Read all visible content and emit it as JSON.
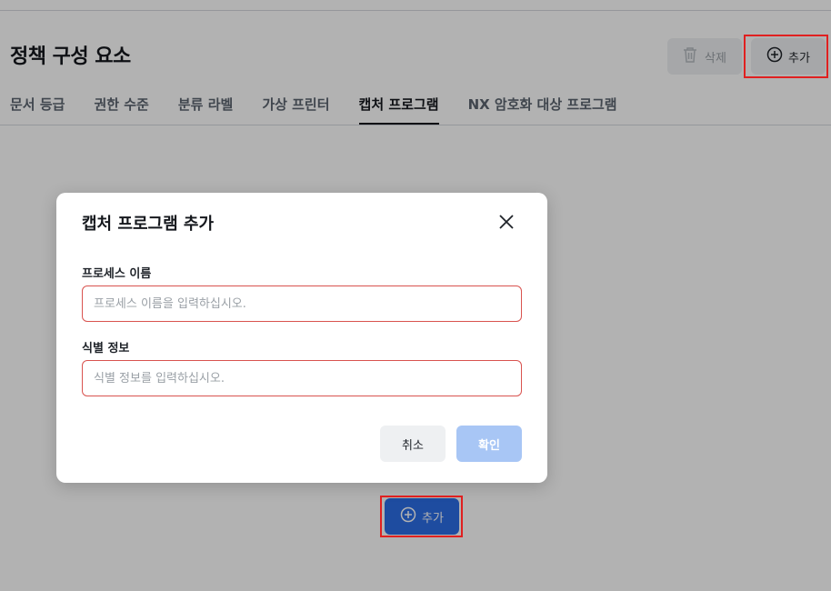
{
  "page": {
    "title": "정책 구성 요소",
    "delete_label": "삭제",
    "add_label": "추가",
    "tabs": [
      {
        "label": "문서 등급"
      },
      {
        "label": "권한 수준"
      },
      {
        "label": "분류 라벨"
      },
      {
        "label": "가상 프린터"
      },
      {
        "label": "캡처 프로그램"
      },
      {
        "label": "NX 암호화 대상 프로그램"
      }
    ],
    "active_tab": "캡처 프로그램",
    "center_add_label": "추가"
  },
  "modal": {
    "title": "캡처 프로그램 추가",
    "process_name": {
      "label": "프로세스 이름",
      "value": "",
      "placeholder": "프로세스 이름을 입력하십시오."
    },
    "identifier": {
      "label": "식별 정보",
      "value": "",
      "placeholder": "식별 정보를 입력하십시오."
    },
    "cancel_label": "취소",
    "confirm_label": "확인"
  },
  "colors": {
    "primary": "#2c6de6",
    "primary_disabled": "#a8c6f5",
    "error_border": "#d9534f",
    "highlight": "#e02020"
  },
  "icons": {
    "delete": "trash-icon",
    "add": "plus-circle-icon",
    "close": "close-icon"
  }
}
